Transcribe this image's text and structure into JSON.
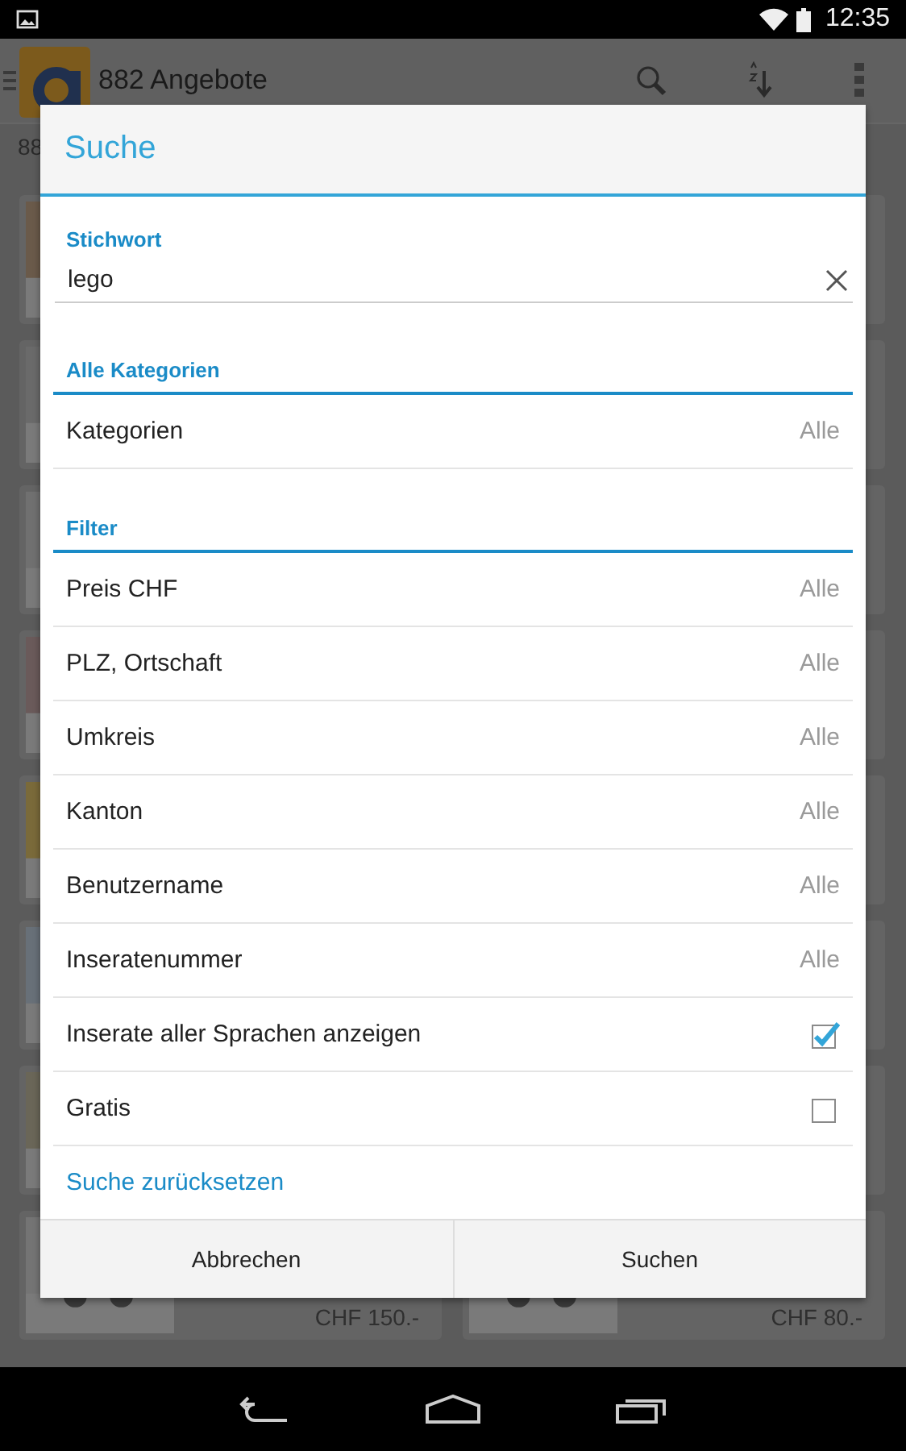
{
  "status_bar": {
    "time": "12:35"
  },
  "app_bar": {
    "title": "882 Angebote"
  },
  "subtitle": "88",
  "listings": [
    {
      "kind": "picture"
    },
    {
      "kind": "plain"
    },
    {
      "kind": "picture"
    },
    {
      "kind": "plain"
    },
    {
      "kind": "picture"
    },
    {
      "kind": "plain"
    },
    {
      "kind": "picture"
    },
    {
      "kind": "plain"
    },
    {
      "kind": "picture"
    },
    {
      "kind": "plain"
    },
    {
      "kind": "picture"
    },
    {
      "kind": "plain"
    },
    {
      "kind": "picture"
    },
    {
      "kind": "plain"
    },
    {
      "kind": "picture",
      "price": "CHF 150.-"
    },
    {
      "kind": "picture",
      "price": "CHF 80.-"
    }
  ],
  "dialog": {
    "title": "Suche",
    "keyword": {
      "label": "Stichwort",
      "value": "lego"
    },
    "sections": [
      {
        "heading": "Alle Kategorien",
        "rows": [
          {
            "kind": "value",
            "label": "Kategorien",
            "value": "Alle"
          }
        ]
      },
      {
        "heading": "Filter",
        "rows": [
          {
            "kind": "value",
            "label": "Preis CHF",
            "value": "Alle"
          },
          {
            "kind": "value",
            "label": "PLZ, Ortschaft",
            "value": "Alle"
          },
          {
            "kind": "value",
            "label": "Umkreis",
            "value": "Alle"
          },
          {
            "kind": "value",
            "label": "Kanton",
            "value": "Alle"
          },
          {
            "kind": "value",
            "label": "Benutzername",
            "value": "Alle"
          },
          {
            "kind": "value",
            "label": "Inseratenummer",
            "value": "Alle"
          },
          {
            "kind": "checkbox",
            "label": "Inserate aller Sprachen anzeigen",
            "checked": true
          },
          {
            "kind": "checkbox",
            "label": "Gratis",
            "checked": false
          }
        ]
      }
    ],
    "reset_link": "Suche zurücksetzen",
    "buttons": [
      "Abbrechen",
      "Suchen"
    ]
  }
}
